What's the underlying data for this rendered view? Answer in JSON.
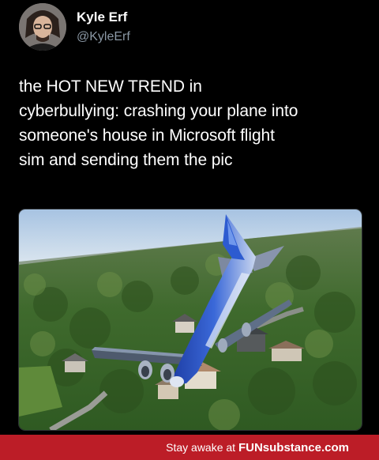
{
  "author": {
    "name": "Kyle Erf",
    "handle": "@KyleErf"
  },
  "tweet": {
    "lines": [
      "the HOT NEW TREND in",
      "cyberbullying: crashing your plane into",
      "someone's house in Microsoft flight",
      "sim and sending them the pic"
    ]
  },
  "footer": {
    "prefix": "Stay awake at",
    "brand": "FUNsubstance.com"
  },
  "colors": {
    "background": "#000000",
    "footer": "#bc1d27",
    "handle": "#8b98a5"
  }
}
